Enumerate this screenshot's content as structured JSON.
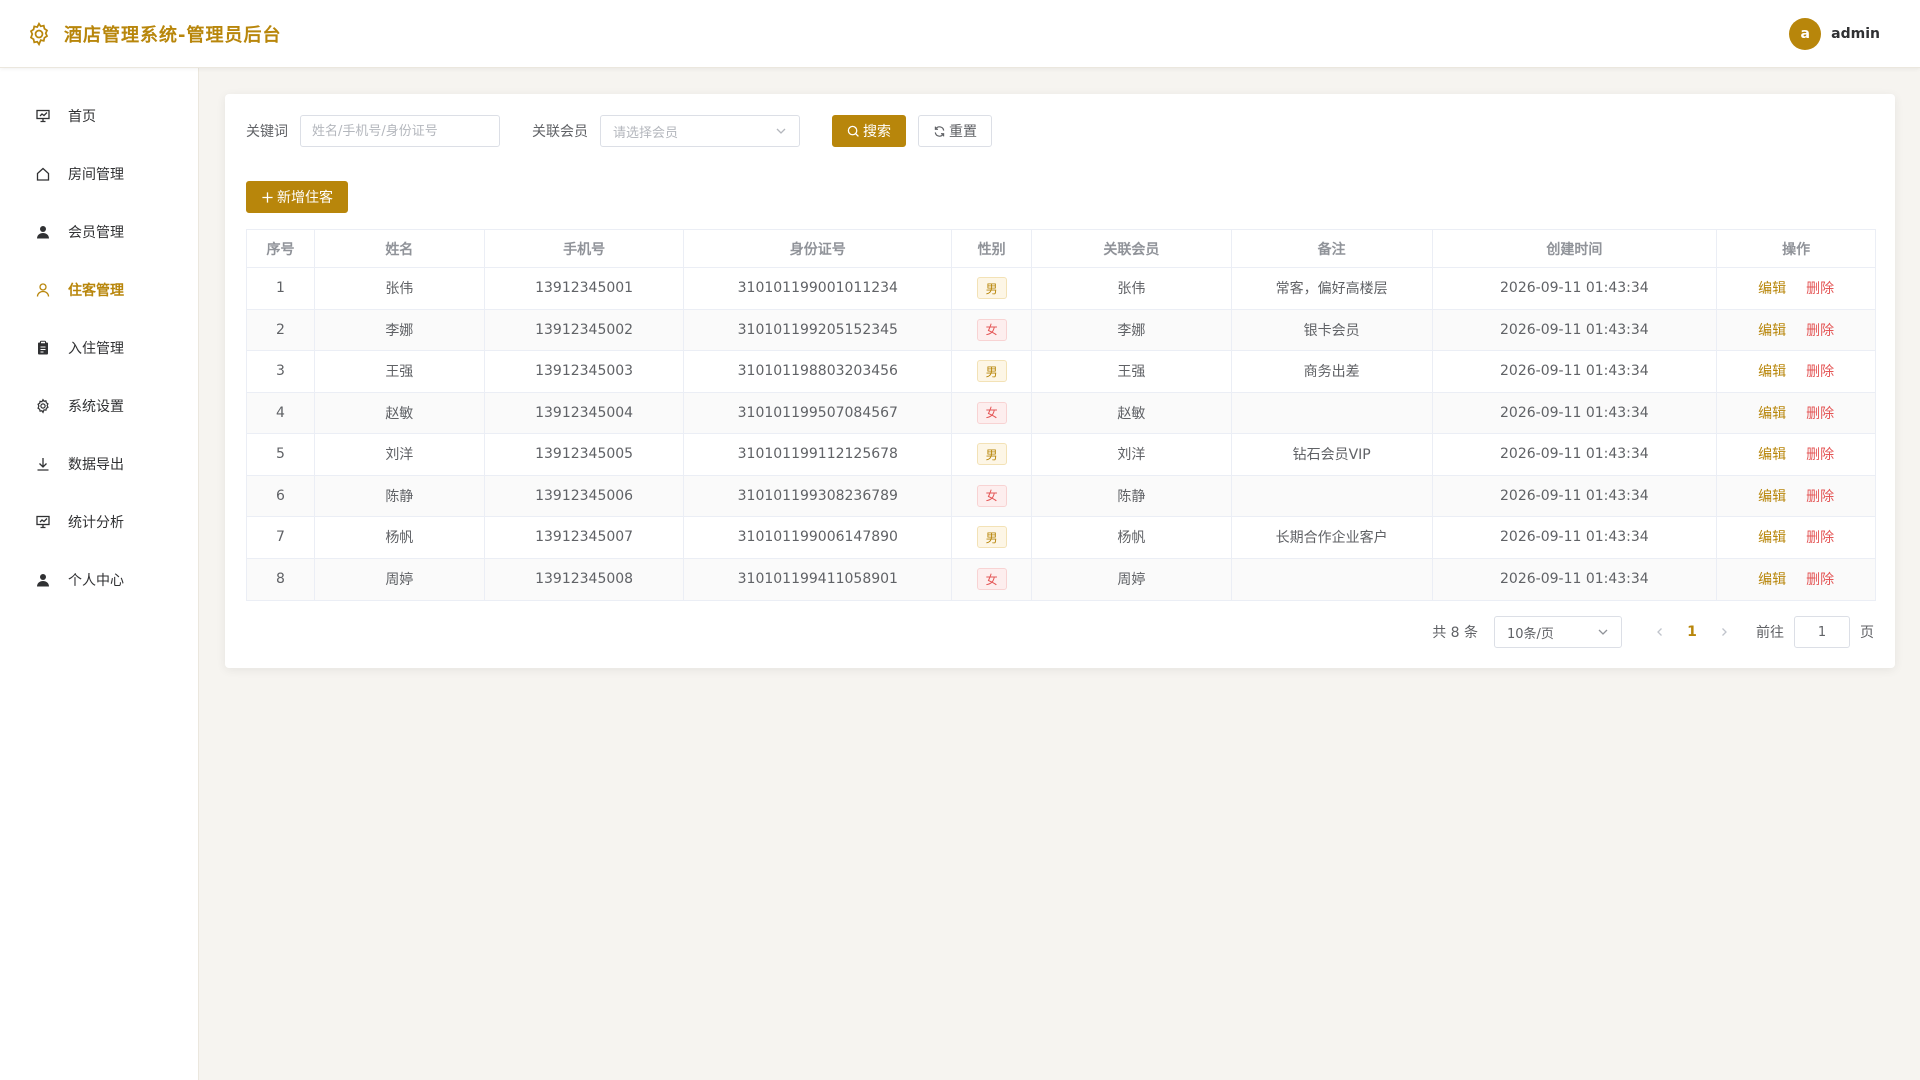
{
  "header": {
    "logo_icon": "gear-icon",
    "title": "酒店管理系统-管理员后台",
    "user": {
      "avatar_letter": "a",
      "name": "admin"
    }
  },
  "theme": {
    "accent": "#b8860b",
    "danger": "#e45656"
  },
  "sidebar": {
    "items": [
      {
        "label": "首页",
        "icon": "presentation-icon",
        "active": false
      },
      {
        "label": "房间管理",
        "icon": "home-icon",
        "active": false
      },
      {
        "label": "会员管理",
        "icon": "user-filled-icon",
        "active": false
      },
      {
        "label": "住客管理",
        "icon": "user-outline-icon",
        "active": true
      },
      {
        "label": "入住管理",
        "icon": "clipboard-icon",
        "active": false
      },
      {
        "label": "系统设置",
        "icon": "gear-icon",
        "active": false
      },
      {
        "label": "数据导出",
        "icon": "download-icon",
        "active": false
      },
      {
        "label": "统计分析",
        "icon": "presentation-icon",
        "active": false
      },
      {
        "label": "个人中心",
        "icon": "user-filled-icon",
        "active": false
      }
    ]
  },
  "filters": {
    "keyword_label": "关键词",
    "keyword_placeholder": "姓名/手机号/身份证号",
    "keyword_value": "",
    "member_label": "关联会员",
    "member_placeholder": "请选择会员",
    "search_label": "搜索",
    "reset_label": "重置"
  },
  "add_button": "新增住客",
  "table": {
    "columns": [
      "序号",
      "姓名",
      "手机号",
      "身份证号",
      "性别",
      "关联会员",
      "备注",
      "创建时间",
      "操作"
    ],
    "edit_label": "编辑",
    "delete_label": "删除",
    "rows": [
      {
        "index": "1",
        "name": "张伟",
        "phone": "13912345001",
        "id_card": "310101199001011234",
        "gender": "男",
        "member": "张伟",
        "note": "常客，偏好高楼层",
        "created": "2026-09-11 01:43:34"
      },
      {
        "index": "2",
        "name": "李娜",
        "phone": "13912345002",
        "id_card": "310101199205152345",
        "gender": "女",
        "member": "李娜",
        "note": "银卡会员",
        "created": "2026-09-11 01:43:34"
      },
      {
        "index": "3",
        "name": "王强",
        "phone": "13912345003",
        "id_card": "310101198803203456",
        "gender": "男",
        "member": "王强",
        "note": "商务出差",
        "created": "2026-09-11 01:43:34"
      },
      {
        "index": "4",
        "name": "赵敏",
        "phone": "13912345004",
        "id_card": "310101199507084567",
        "gender": "女",
        "member": "赵敏",
        "note": "",
        "created": "2026-09-11 01:43:34"
      },
      {
        "index": "5",
        "name": "刘洋",
        "phone": "13912345005",
        "id_card": "310101199112125678",
        "gender": "男",
        "member": "刘洋",
        "note": "钻石会员VIP",
        "created": "2026-09-11 01:43:34"
      },
      {
        "index": "6",
        "name": "陈静",
        "phone": "13912345006",
        "id_card": "310101199308236789",
        "gender": "女",
        "member": "陈静",
        "note": "",
        "created": "2026-09-11 01:43:34"
      },
      {
        "index": "7",
        "name": "杨帆",
        "phone": "13912345007",
        "id_card": "310101199006147890",
        "gender": "男",
        "member": "杨帆",
        "note": "长期合作企业客户",
        "created": "2026-09-11 01:43:34"
      },
      {
        "index": "8",
        "name": "周婷",
        "phone": "13912345008",
        "id_card": "310101199411058901",
        "gender": "女",
        "member": "周婷",
        "note": "",
        "created": "2026-09-11 01:43:34"
      }
    ]
  },
  "pagination": {
    "total_text": "共 8 条",
    "page_size": "10条/页",
    "current_page": "1",
    "goto_label": "前往",
    "goto_value": "1",
    "goto_suffix": "页"
  }
}
